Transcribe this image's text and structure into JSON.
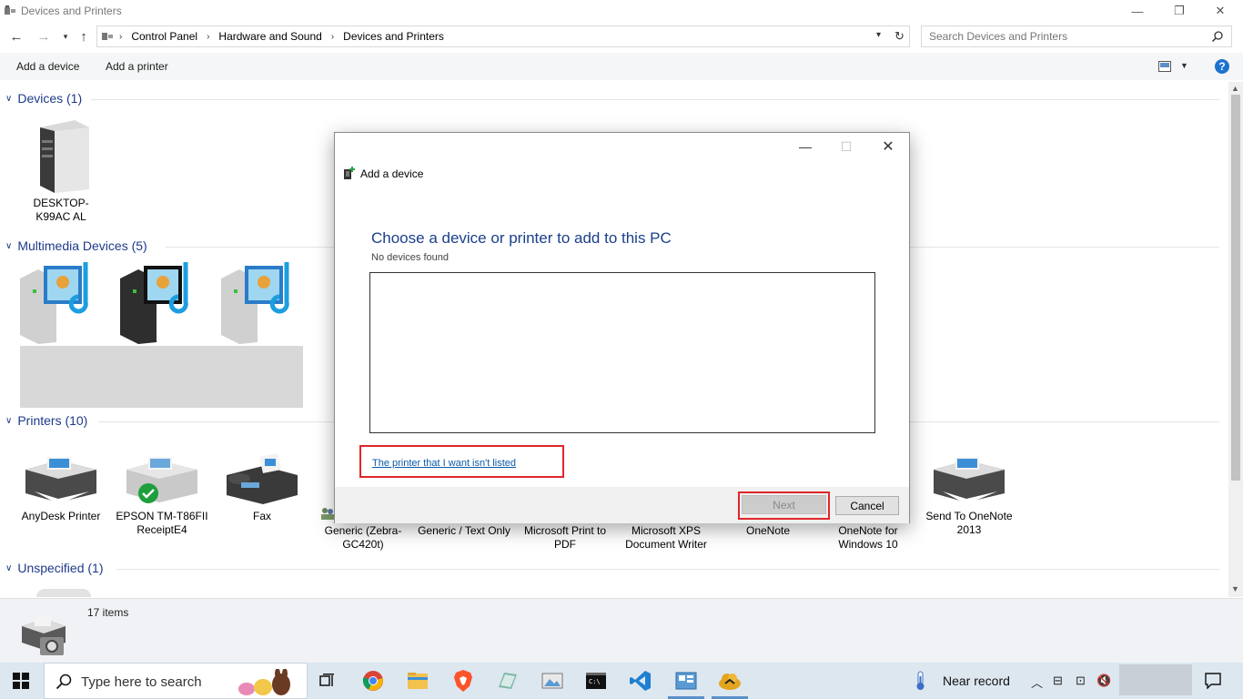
{
  "window": {
    "title": "Devices and Printers",
    "minimize": "—",
    "restore": "❐",
    "close": "✕"
  },
  "address": {
    "crumbs": [
      "Control Panel",
      "Hardware and Sound",
      "Devices and Printers"
    ],
    "search_placeholder": "Search Devices and Printers"
  },
  "commands": {
    "add_device": "Add a device",
    "add_printer": "Add a printer",
    "help": "?"
  },
  "groups": {
    "devices": {
      "label": "Devices (1)",
      "items": [
        {
          "label": "DESKTOP-K99AC AL"
        }
      ]
    },
    "multimedia": {
      "label": "Multimedia Devices (5)"
    },
    "printers": {
      "label": "Printers (10)",
      "items": [
        {
          "label": "AnyDesk Printer"
        },
        {
          "label": "EPSON TM-T86FII ReceiptE4"
        },
        {
          "label": "Fax"
        },
        {
          "label": "Generic (Zebra-GC420t)"
        },
        {
          "label": "Generic / Text Only"
        },
        {
          "label": "Microsoft Print to PDF"
        },
        {
          "label": "Microsoft XPS Document Writer"
        },
        {
          "label": "OneNote"
        },
        {
          "label": "OneNote for Windows 10"
        },
        {
          "label": "Send To OneNote 2013"
        }
      ]
    },
    "unspecified": {
      "label": "Unspecified (1)"
    }
  },
  "dialog": {
    "title": "Add a device",
    "heading": "Choose a device or printer to add to this PC",
    "subtext": "No devices found",
    "link": "The printer that I want isn't listed",
    "next": "Next",
    "cancel": "Cancel"
  },
  "status": {
    "count": "17 items"
  },
  "taskbar": {
    "search_text": "Type here to search",
    "weather": "Near record"
  },
  "colors": {
    "accent": "#1e3a8a",
    "highlight_red": "#e0262a",
    "link": "#0b5aa6"
  }
}
